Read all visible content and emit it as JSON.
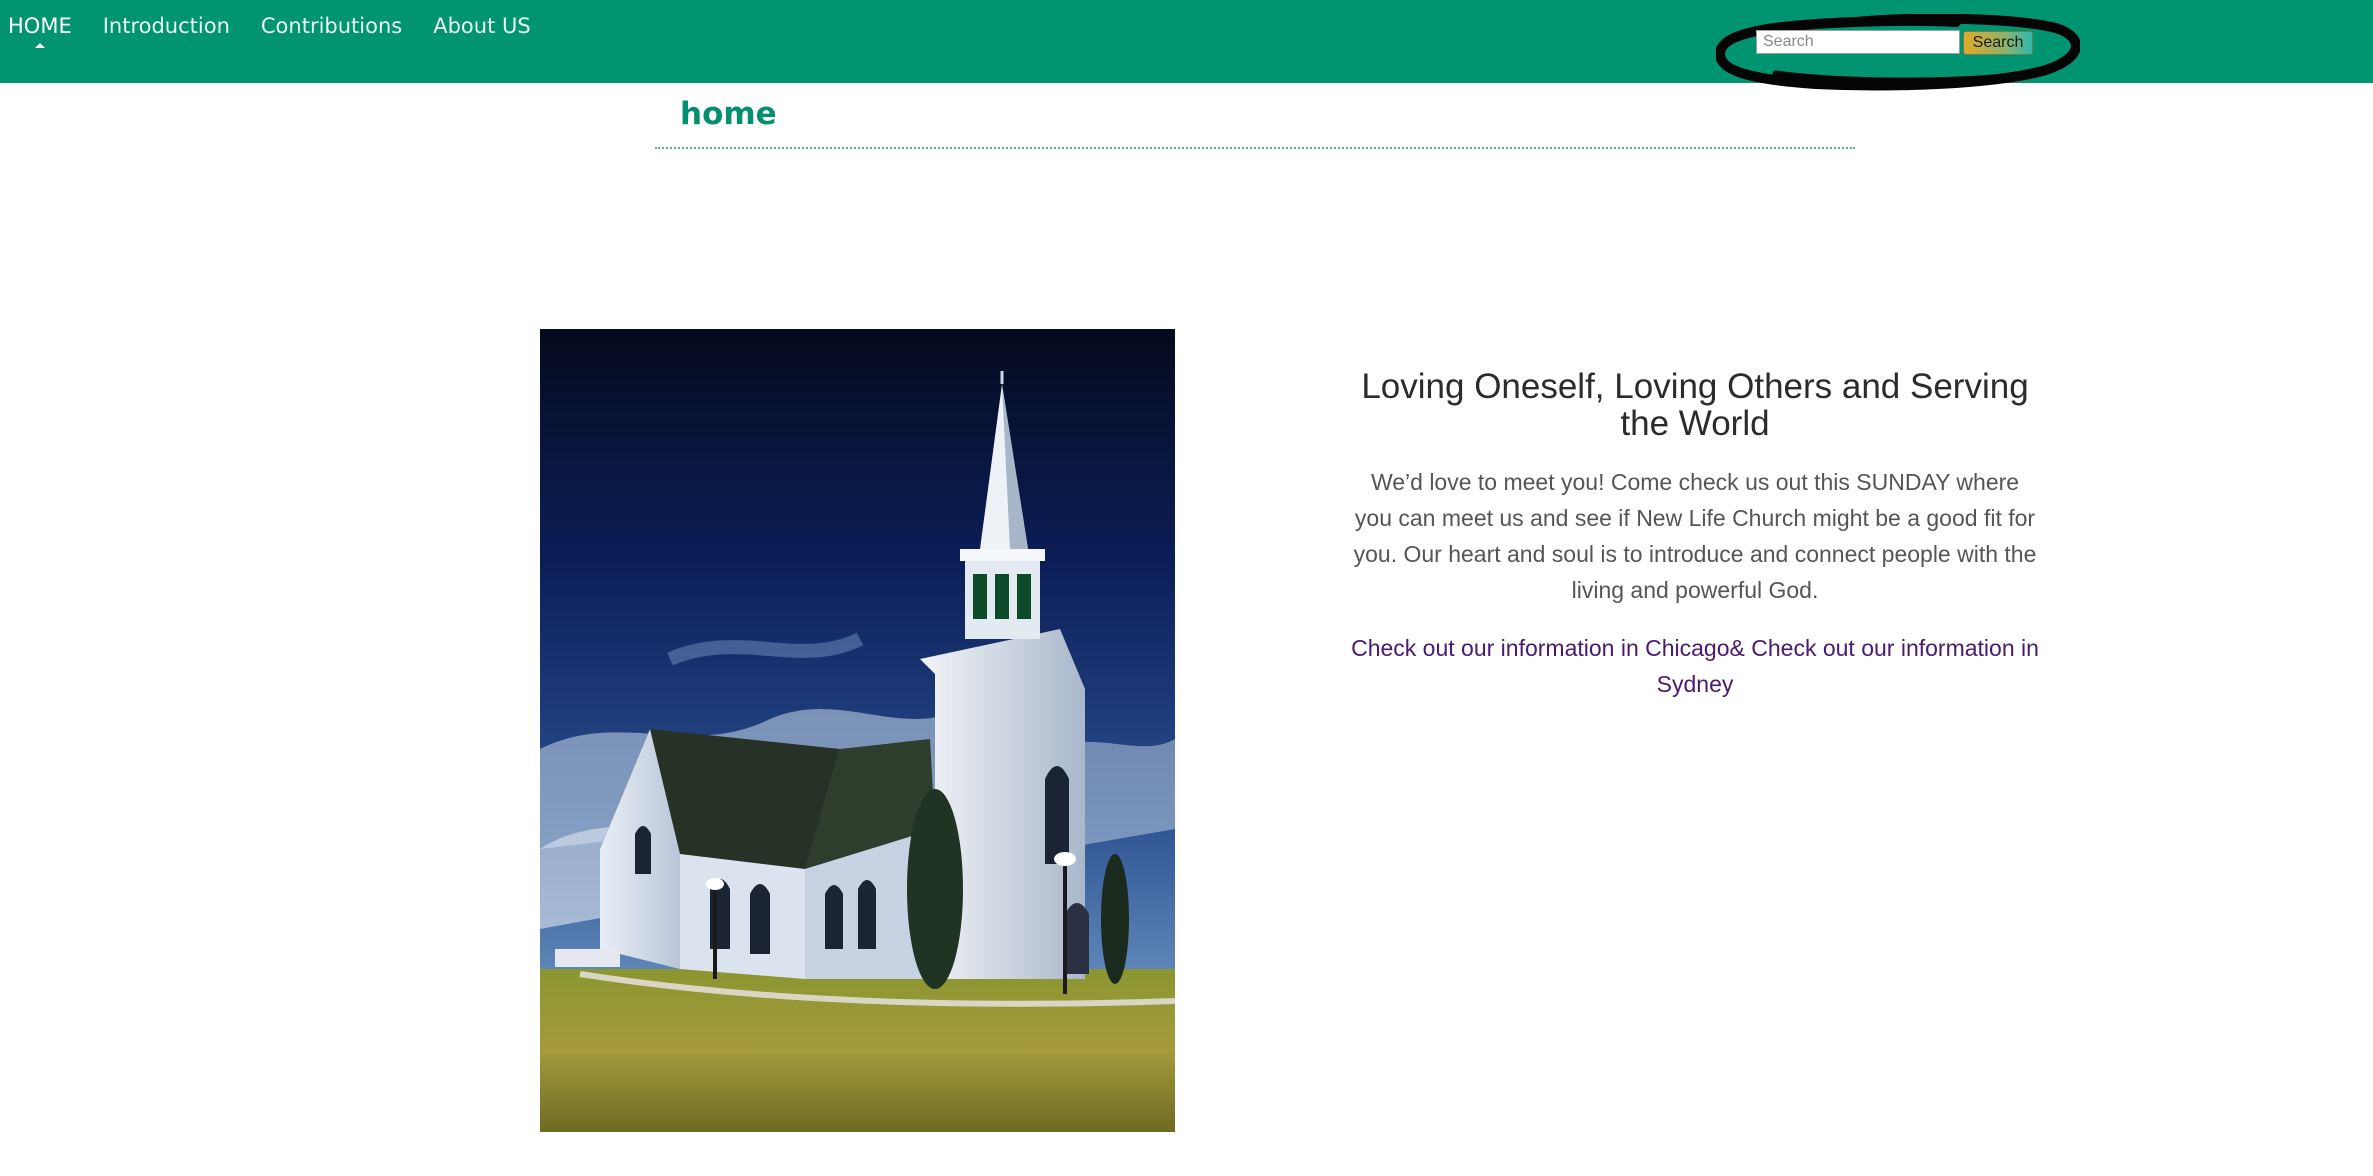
{
  "nav": {
    "items": [
      {
        "label": "HOME",
        "active": true
      },
      {
        "label": "Introduction",
        "active": false
      },
      {
        "label": "Contributions",
        "active": false
      },
      {
        "label": "About US",
        "active": false
      }
    ]
  },
  "search": {
    "placeholder": "Search",
    "button_label": "Search"
  },
  "page": {
    "heading": "home"
  },
  "main": {
    "headline": "Loving Oneself, Loving Others and Serving the World",
    "paragraph": "We’d love to meet you! Come check us out this SUNDAY where you can meet us and see if New Life Church might be a good fit for you. Our heart and soul is to introduce and connect people with the living and powerful God.",
    "link_chicago": "Check out our information in Chicago",
    "link_separator": "& ",
    "link_sydney": "Check out our information in Sydney"
  },
  "colors": {
    "nav_bg": "#009471",
    "heading": "#04906f",
    "link": "#4a1a6e"
  },
  "icons": {
    "photo": "church-photo",
    "annotation": "hand-drawn-circle"
  }
}
